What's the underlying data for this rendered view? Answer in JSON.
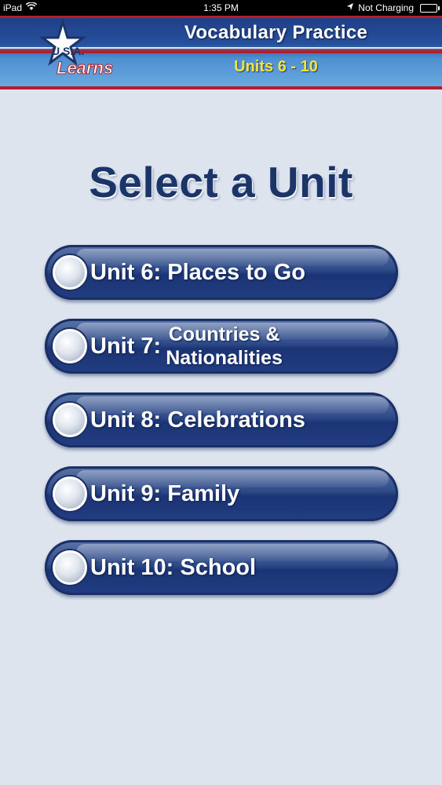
{
  "status_bar": {
    "device": "iPad",
    "time": "1:35 PM",
    "charging": "Not Charging"
  },
  "header": {
    "logo_text_top": "U.S.A.",
    "logo_text_bottom": "Learns",
    "title": "Vocabulary Practice",
    "subtitle": "Units 6 - 10"
  },
  "heading": "Select a Unit",
  "units": [
    {
      "label": "Unit 6: Places to Go"
    },
    {
      "prefix": "Unit 7:",
      "line1": "Countries &",
      "line2": "Nationalities"
    },
    {
      "label": "Unit 8: Celebrations"
    },
    {
      "label": "Unit 9: Family"
    },
    {
      "label": "Unit 10: School"
    }
  ],
  "colors": {
    "header_blue": "#27509c",
    "header_red": "#b21f2b",
    "subtitle_yellow": "#f6e43a",
    "background": "#dde4ee",
    "heading_navy": "#1b3569",
    "button_blue": "#2f4c89"
  }
}
